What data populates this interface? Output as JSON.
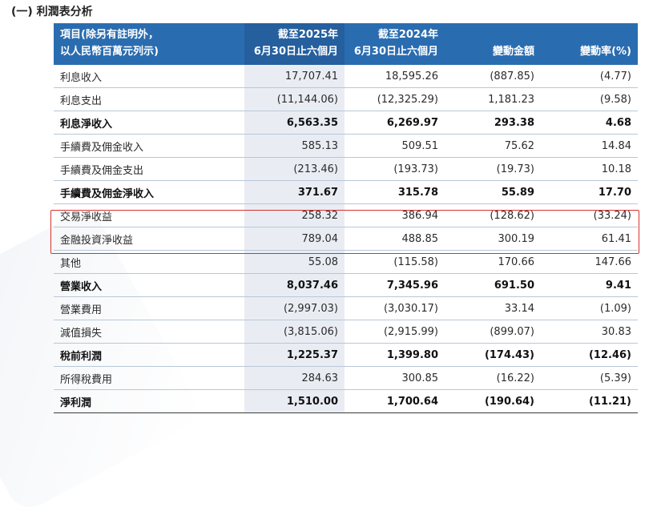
{
  "section_title": "(一) 利潤表分析",
  "header": {
    "col0": [
      "項目(除另有註明外，",
      "以人民幣百萬元列示)"
    ],
    "col1": [
      "截至2025年",
      "6月30日止六個月"
    ],
    "col2": [
      "截至2024年",
      "6月30日止六個月"
    ],
    "col3": "變動金額",
    "col4": "變動率(%)"
  },
  "rows": [
    {
      "label": "利息收入",
      "v2025": "17,707.41",
      "v2024": "18,595.26",
      "change": "(887.85)",
      "rate": "(4.77)",
      "bold": false
    },
    {
      "label": "利息支出",
      "v2025": "(11,144.06)",
      "v2024": "(12,325.29)",
      "change": "1,181.23",
      "rate": "(9.58)",
      "bold": false
    },
    {
      "label": "利息淨收入",
      "v2025": "6,563.35",
      "v2024": "6,269.97",
      "change": "293.38",
      "rate": "4.68",
      "bold": true
    },
    {
      "label": "手續費及佣金收入",
      "v2025": "585.13",
      "v2024": "509.51",
      "change": "75.62",
      "rate": "14.84",
      "bold": false
    },
    {
      "label": "手續費及佣金支出",
      "v2025": "(213.46)",
      "v2024": "(193.73)",
      "change": "(19.73)",
      "rate": "10.18",
      "bold": false
    },
    {
      "label": "手續費及佣金淨收入",
      "v2025": "371.67",
      "v2024": "315.78",
      "change": "55.89",
      "rate": "17.70",
      "bold": true
    },
    {
      "label": "交易淨收益",
      "v2025": "258.32",
      "v2024": "386.94",
      "change": "(128.62)",
      "rate": "(33.24)",
      "bold": false
    },
    {
      "label": "金融投資淨收益",
      "v2025": "789.04",
      "v2024": "488.85",
      "change": "300.19",
      "rate": "61.41",
      "bold": false
    },
    {
      "label": "其他",
      "v2025": "55.08",
      "v2024": "(115.58)",
      "change": "170.66",
      "rate": "147.66",
      "bold": false
    },
    {
      "label": "營業收入",
      "v2025": "8,037.46",
      "v2024": "7,345.96",
      "change": "691.50",
      "rate": "9.41",
      "bold": true
    },
    {
      "label": "營業費用",
      "v2025": "(2,997.03)",
      "v2024": "(3,030.17)",
      "change": "33.14",
      "rate": "(1.09)",
      "bold": false
    },
    {
      "label": "減值損失",
      "v2025": "(3,815.06)",
      "v2024": "(2,915.99)",
      "change": "(899.07)",
      "rate": "30.83",
      "bold": false
    },
    {
      "label": "稅前利潤",
      "v2025": "1,225.37",
      "v2024": "1,399.80",
      "change": "(174.43)",
      "rate": "(12.46)",
      "bold": true
    },
    {
      "label": "所得稅費用",
      "v2025": "284.63",
      "v2024": "300.85",
      "change": "(16.22)",
      "rate": "(5.39)",
      "bold": false
    },
    {
      "label": "淨利潤",
      "v2025": "1,510.00",
      "v2024": "1,700.64",
      "change": "(190.64)",
      "rate": "(11.21)",
      "bold": true
    }
  ],
  "colors": {
    "header_bg": "#2a6cb0",
    "current_period_bg": "#e9edf3",
    "highlight_border": "#d8322f"
  }
}
